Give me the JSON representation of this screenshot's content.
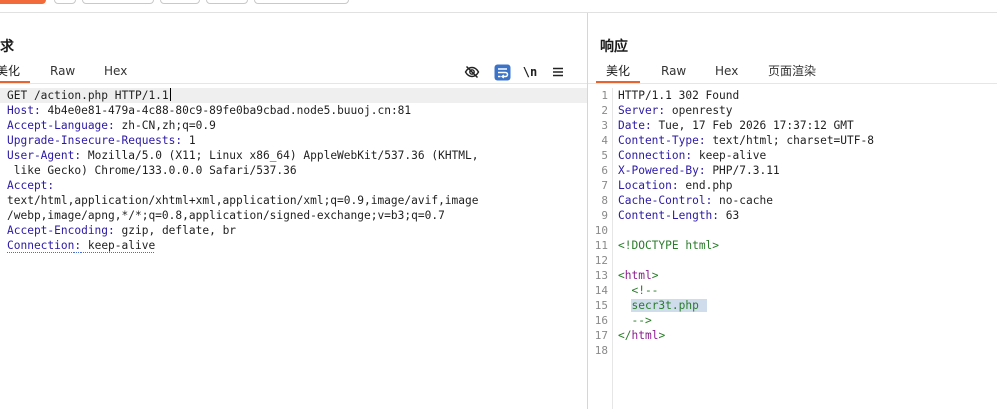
{
  "request_pane": {
    "title": "请求",
    "tabs": [
      {
        "label": "美化",
        "active": true
      },
      {
        "label": "Raw",
        "active": false
      },
      {
        "label": "Hex",
        "active": false
      }
    ],
    "toolbar": {
      "icons": [
        "eye-off-icon",
        "wrap-icon",
        "newline-icon",
        "menu-icon"
      ],
      "newline_label": "\\n"
    },
    "lines": [
      {
        "text": "GET /action.php HTTP/1.1"
      },
      {
        "key": "Host",
        "value": " 4b4e0e81-479a-4c88-80c9-89fe0ba9cbad.node5.buuoj.cn:81"
      },
      {
        "key": "Accept-Language",
        "value": " zh-CN,zh;q=0.9"
      },
      {
        "key": "Upgrade-Insecure-Requests",
        "value": " 1"
      },
      {
        "key": "User-Agent",
        "value": " Mozilla/5.0 (X11; Linux x86_64) AppleWebKit/537.36 (KHTML,"
      },
      {
        "text": " like Gecko) Chrome/133.0.0.0 Safari/537.36"
      },
      {
        "key": "Accept",
        "value": ""
      },
      {
        "text": "text/html,application/xhtml+xml,application/xml;q=0.9,image/avif,image"
      },
      {
        "text": "/webp,image/apng,*/*;q=0.8,application/signed-exchange;v=b3;q=0.7"
      },
      {
        "key": "Accept-Encoding",
        "value": " gzip, deflate, br"
      },
      {
        "key": "Connection",
        "value": " keep-alive"
      }
    ]
  },
  "response_pane": {
    "title": "响应",
    "tabs": [
      {
        "label": "美化",
        "active": true
      },
      {
        "label": "Raw",
        "active": false
      },
      {
        "label": "Hex",
        "active": false
      },
      {
        "label": "页面渲染",
        "active": false
      }
    ],
    "line_numbers": [
      "1",
      "2",
      "3",
      "4",
      "5",
      "6",
      "7",
      "8",
      "9",
      "10",
      "11",
      "12",
      "13",
      "14",
      "15",
      "16",
      "17",
      "18"
    ],
    "lines": [
      {
        "text": "HTTP/1.1 302 Found"
      },
      {
        "key": "Server",
        "value": " openresty"
      },
      {
        "key": "Date",
        "value": " Tue, 17 Feb 2026 17:37:12 GMT"
      },
      {
        "key": "Content-Type",
        "value": " text/html; charset=UTF-8"
      },
      {
        "key": "Connection",
        "value": " keep-alive"
      },
      {
        "key": "X-Powered-By",
        "value": " PHP/7.3.11"
      },
      {
        "key": "Location",
        "value": " end.php"
      },
      {
        "key": "Cache-Control",
        "value": " no-cache"
      },
      {
        "key": "Content-Length",
        "value": " 63"
      },
      {
        "text": ""
      },
      {
        "text": "<!DOCTYPE html>"
      },
      {
        "text": ""
      },
      {
        "open": "<",
        "tag": "html",
        "close": ">"
      },
      {
        "text": "  <!--"
      },
      {
        "text": "secr3t.php"
      },
      {
        "text": "  -->"
      },
      {
        "open": "</",
        "tag": "html",
        "close": ">"
      },
      {
        "text": ""
      }
    ]
  },
  "colors": {
    "accent": "#e8632f",
    "header_key": "#2a19a6",
    "html_tag": "#8b1f8f",
    "comment": "#2a7c2a",
    "highlight": "#cfdcec"
  }
}
